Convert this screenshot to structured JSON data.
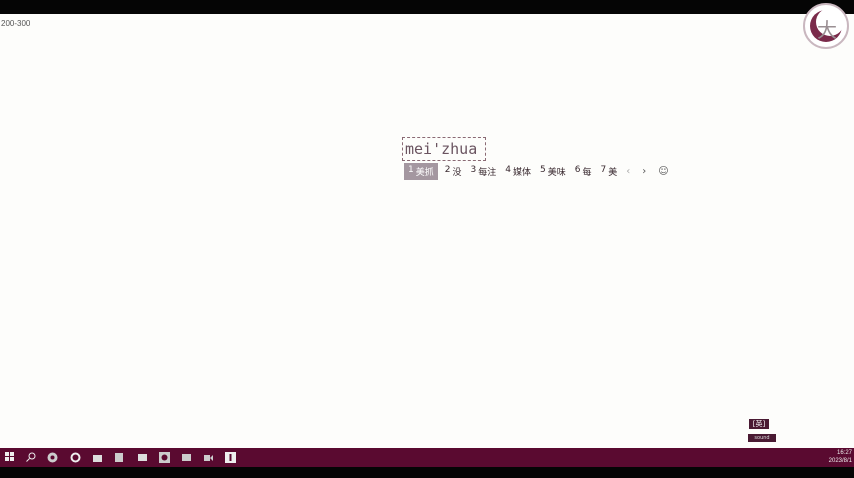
{
  "corner_label": "200-300",
  "logo": {
    "glyph": "大",
    "icon": "circle-logo"
  },
  "ime": {
    "composition": "mei'zhua",
    "candidates": [
      {
        "index": "1",
        "text": "美抓",
        "selected": true
      },
      {
        "index": "2",
        "text": "没",
        "selected": false
      },
      {
        "index": "3",
        "text": "每注",
        "selected": false
      },
      {
        "index": "4",
        "text": "媒体",
        "selected": false
      },
      {
        "index": "5",
        "text": "美味",
        "selected": false
      },
      {
        "index": "6",
        "text": "每",
        "selected": false
      },
      {
        "index": "7",
        "text": "美",
        "selected": false
      }
    ],
    "prev": "‹",
    "next": "›",
    "emoji": "☺"
  },
  "badges": {
    "top": "[英]",
    "bottom": "sound"
  },
  "taskbar": {
    "icons": [
      "windows-icon",
      "search-icon",
      "chrome-icon",
      "settings-icon",
      "explorer-icon",
      "file-icon",
      "terminal-icon",
      "cmd-icon",
      "app-icon",
      "video-icon",
      "text-icon"
    ],
    "time": "16:27",
    "date": "2023/8/1"
  }
}
